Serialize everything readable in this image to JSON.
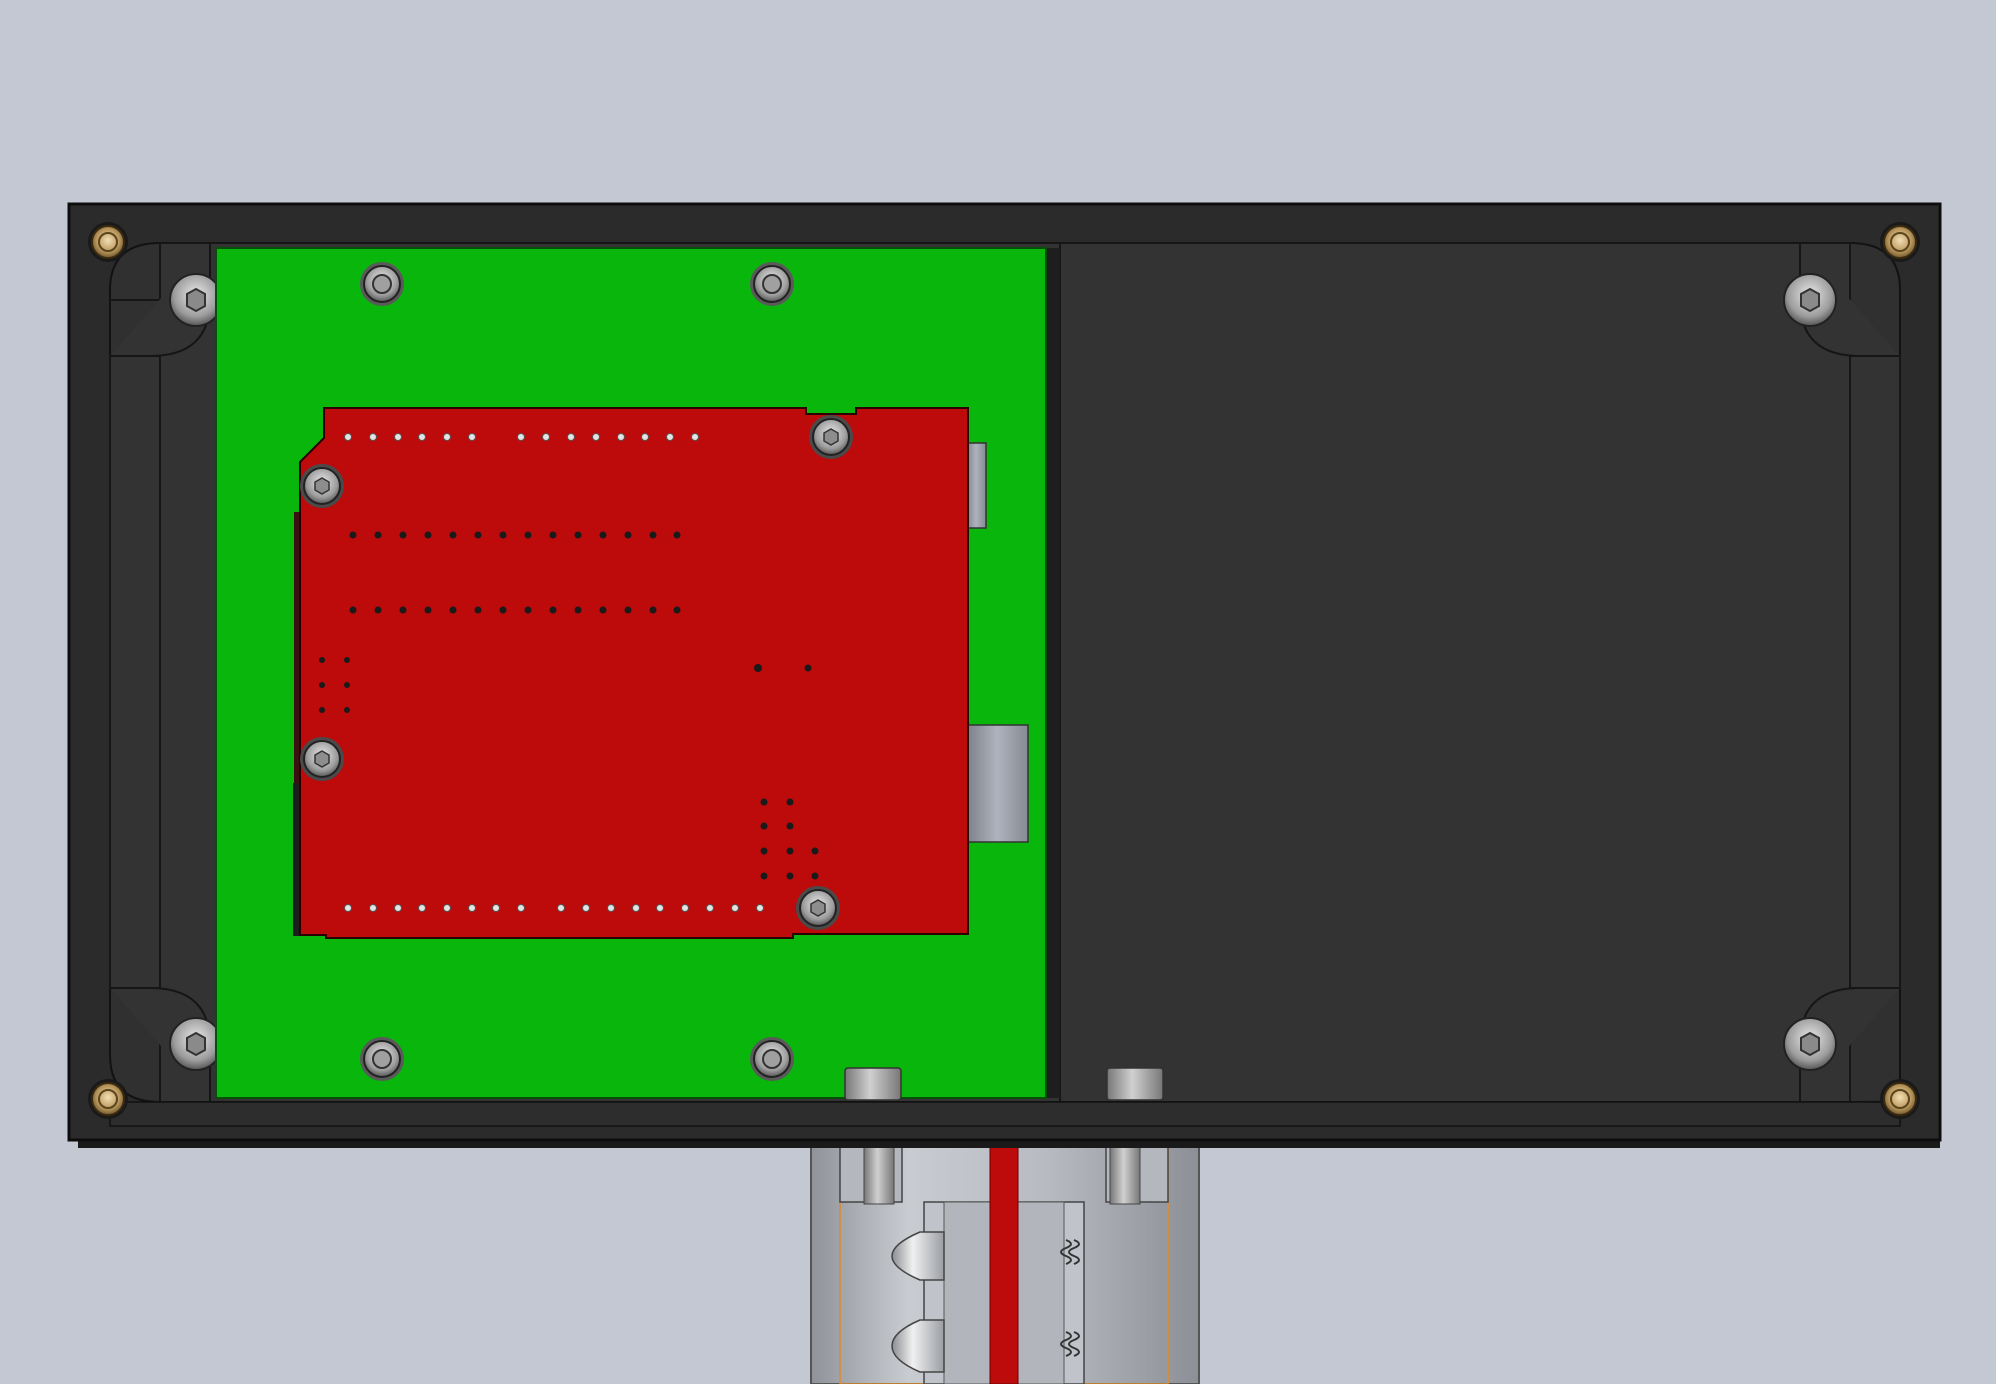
{
  "app": {
    "view": "cad-3d-viewport",
    "description_visible_text": ""
  },
  "colors": {
    "background": "#c3c8d3",
    "enclosure_outer": "#2b2b2b",
    "enclosure_inner": "#333333",
    "enclosure_edge": "#111111",
    "carrier_board": "#09b60b",
    "arduino_board": "#bd0a0b",
    "brass_insert": "#b38a4a",
    "screw_steel": "#9a9a9a",
    "connector_metal": "#9ea3ae",
    "mount_tube": "#b4b8be",
    "highlight_orange": "#e08a2a"
  },
  "parts": [
    {
      "id": "enclosure-box",
      "icon": "enclosure-icon"
    },
    {
      "id": "carrier-pcb",
      "icon": "pcb-icon"
    },
    {
      "id": "arduino-board",
      "icon": "microcontroller-icon"
    },
    {
      "id": "usb-connector",
      "icon": "usb-port-icon"
    },
    {
      "id": "dc-power-jack",
      "icon": "power-jack-icon"
    },
    {
      "id": "mounting-bracket",
      "icon": "bracket-icon"
    },
    {
      "id": "hex-screws",
      "icon": "screw-icon"
    },
    {
      "id": "brass-inserts",
      "icon": "insert-icon"
    }
  ]
}
